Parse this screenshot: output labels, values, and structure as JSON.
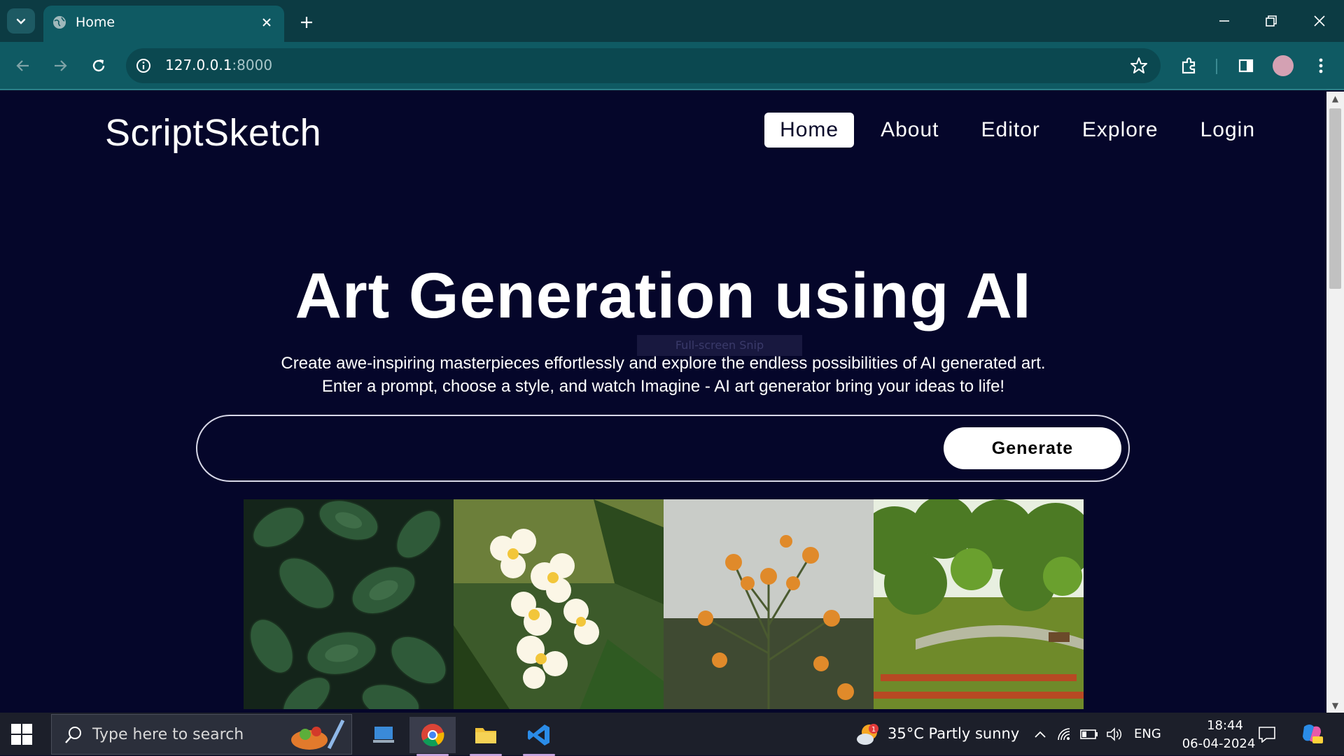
{
  "browser": {
    "tab_title": "Home",
    "url_host": "127.0.0.1",
    "url_port": ":8000"
  },
  "page": {
    "logo": "ScriptSketch",
    "nav": [
      {
        "label": "Home",
        "active": true
      },
      {
        "label": "About",
        "active": false
      },
      {
        "label": "Editor",
        "active": false
      },
      {
        "label": "Explore",
        "active": false
      },
      {
        "label": "Login",
        "active": false
      }
    ],
    "hero_title": "Art Generation using AI",
    "hero_sub_line1": "Create awe-inspiring masterpieces effortlessly and explore the endless possibilities of AI generated art.",
    "hero_sub_line2": "Enter a prompt, choose a style, and watch Imagine - AI art generator bring your ideas to life!",
    "snip_overlay": "Full-screen Snip",
    "prompt_value": "",
    "generate_label": "Generate",
    "gallery": [
      {
        "name": "dark-green-leaves-image"
      },
      {
        "name": "white-plumeria-flowers-image"
      },
      {
        "name": "orange-wildflowers-image"
      },
      {
        "name": "green-park-image"
      }
    ]
  },
  "taskbar": {
    "search_placeholder": "Type here to search",
    "weather": "35°C  Partly sunny",
    "weather_badge": "1",
    "lang": "ENG",
    "time": "18:44",
    "date": "06-04-2024"
  },
  "colors": {
    "page_bg": "#05062a",
    "tabbar_bg": "#0c3b43",
    "toolbar_bg": "#0f5a63",
    "taskbar_bg": "#1c1f2a"
  }
}
